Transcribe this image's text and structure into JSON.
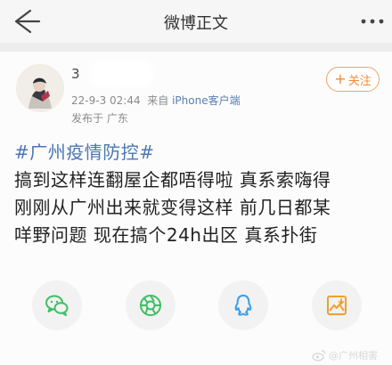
{
  "header": {
    "title": "微博正文",
    "back_icon": "back-arrow-icon",
    "more_icon": "more-dots-icon"
  },
  "post": {
    "username": "3",
    "timestamp": "22-9-3 02:44",
    "source_prefix": "来自",
    "device": "iPhone客户端",
    "location": "发布于 广东",
    "follow_label": "关注",
    "hashtag": "#广州疫情防控#",
    "body_lines": [
      "搞到这样连翻屋企都唔得啦 真系索嗨得",
      "刚刚从广州出来就变得这样 前几日都某",
      "咩野问题 现在搞个24h出区 真系扑街"
    ]
  },
  "share": {
    "items": [
      {
        "name": "wechat",
        "icon": "wechat-icon",
        "color": "#3bbf62"
      },
      {
        "name": "moments",
        "icon": "moments-icon",
        "color": "#3bbf62"
      },
      {
        "name": "qq",
        "icon": "qq-icon",
        "color": "#3a9ee8"
      },
      {
        "name": "save-image",
        "icon": "save-image-icon",
        "color": "#f0a030"
      }
    ]
  },
  "watermark": {
    "text": "@广州相害"
  }
}
